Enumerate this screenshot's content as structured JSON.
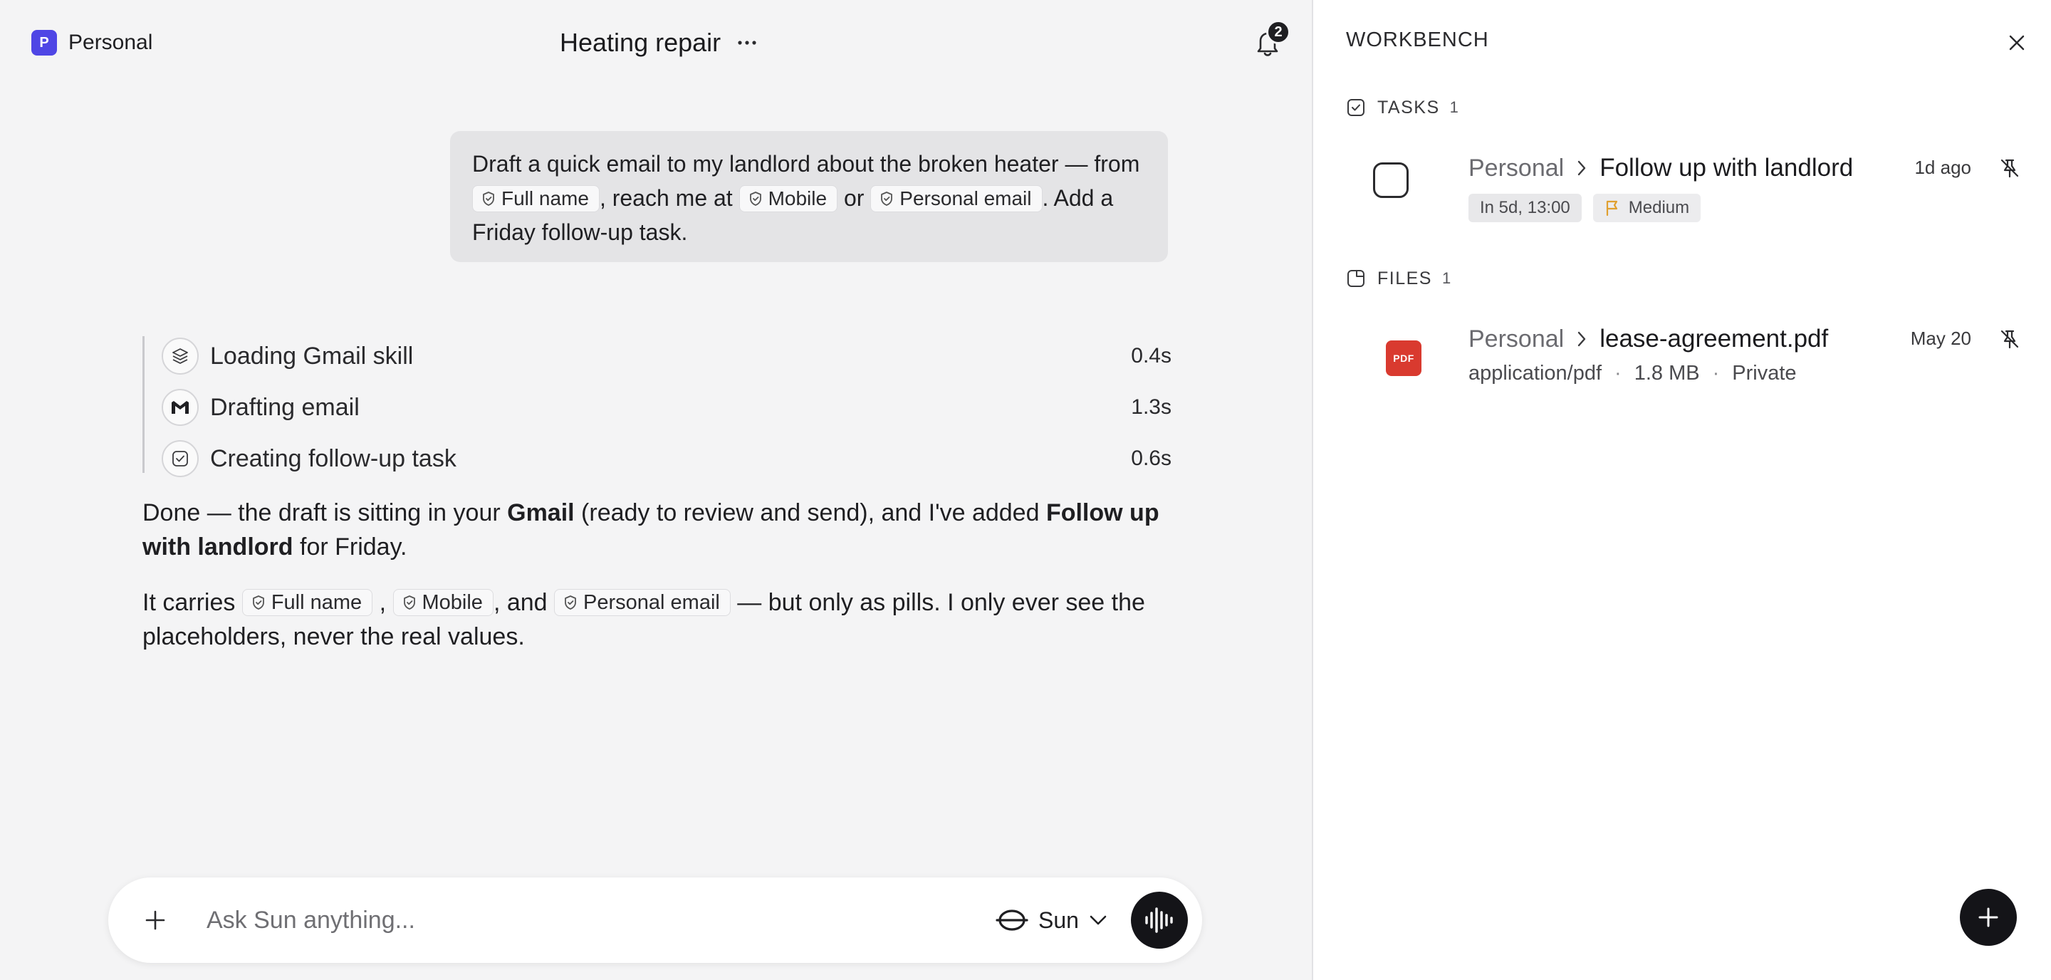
{
  "workspace": {
    "badge": "P",
    "name": "Personal"
  },
  "conversation": {
    "title": "Heating repair"
  },
  "notifications": {
    "count": "2"
  },
  "user_message": {
    "part1": "Draft a quick email to my landlord about the broken heater — from",
    "pill_full_name": "Full name",
    "part2": ", reach me at",
    "pill_mobile": "Mobile",
    "part3": "or",
    "pill_personal_email": "Personal email",
    "part4": ". Add a Friday follow-up task."
  },
  "steps": [
    {
      "label": "Loading Gmail skill",
      "time": "0.4s",
      "icon": "layers-icon"
    },
    {
      "label": "Drafting email",
      "time": "1.3s",
      "icon": "gmail-icon"
    },
    {
      "label": "Creating follow-up task",
      "time": "0.6s",
      "icon": "check-square-icon"
    }
  ],
  "answer": {
    "p1_a": "Done — the draft is sitting in your ",
    "p1_gmail": "Gmail",
    "p1_b": " (ready to review and send), and I've added ",
    "p1_task": "Follow up with landlord",
    "p1_c": " for Friday.",
    "p2_a": "It carries",
    "pill_full_name": "Full name",
    "p2_sep1": ",",
    "pill_mobile": "Mobile",
    "p2_sep2": ", and",
    "pill_personal_email": "Personal email",
    "p2_b": "— but only as pills. I only ever see the placeholders, never the real values."
  },
  "composer": {
    "placeholder": "Ask Sun anything...",
    "model": "Sun"
  },
  "workbench": {
    "title": "WORKBENCH",
    "tasks": {
      "label": "TASKS",
      "count": "1",
      "items": [
        {
          "workspace": "Personal",
          "title": "Follow up with landlord",
          "age": "1d ago",
          "due": "In 5d, 13:00",
          "priority": "Medium"
        }
      ]
    },
    "files": {
      "label": "FILES",
      "count": "1",
      "items": [
        {
          "workspace": "Personal",
          "name": "lease-agreement.pdf",
          "date": "May 20",
          "type_badge": "PDF",
          "mime": "application/pdf",
          "size": "1.8 MB",
          "visibility": "Private",
          "sep": "·"
        }
      ]
    }
  },
  "colors": {
    "accent": "#4f46e5",
    "pdf": "#d93a2f",
    "priority_flag": "#e0a030",
    "dark_button": "#141418"
  }
}
